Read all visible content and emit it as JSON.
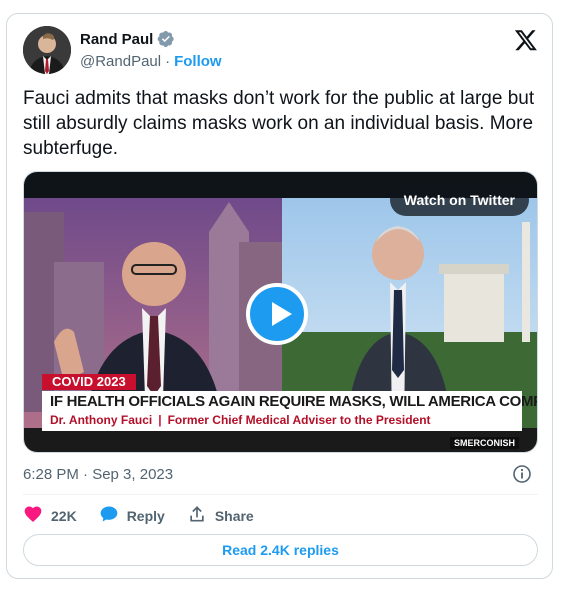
{
  "author": {
    "name": "Rand Paul",
    "handle": "@RandPaul",
    "separator": "·",
    "follow_label": "Follow",
    "verified_color": "#829aab"
  },
  "brand_icon": "x-logo-icon",
  "tweet": {
    "text": "Fauci admits that masks don’t work for the public at large but still absurdly claims masks work on an individual basis.  More subterfuge."
  },
  "media": {
    "watch_label": "Watch on Twitter",
    "chyron_tag": "COVID 2023",
    "chyron_headline": "IF HEALTH OFFICIALS AGAIN REQUIRE MASKS, WILL AMERICA COMPLY?",
    "chyron_name": "Dr. Anthony Fauci",
    "chyron_sep": "|",
    "chyron_title": "Former Chief Medical Adviser to the President",
    "show_label": "SMERCONISH"
  },
  "meta": {
    "timestamp": "6:28 PM · Sep 3, 2023"
  },
  "actions": {
    "like_count": "22K",
    "reply_label": "Reply",
    "share_label": "Share"
  },
  "replies_button": "Read 2.4K replies",
  "colors": {
    "accent": "#1d9bf0",
    "like": "#f91880",
    "muted": "#536471"
  }
}
